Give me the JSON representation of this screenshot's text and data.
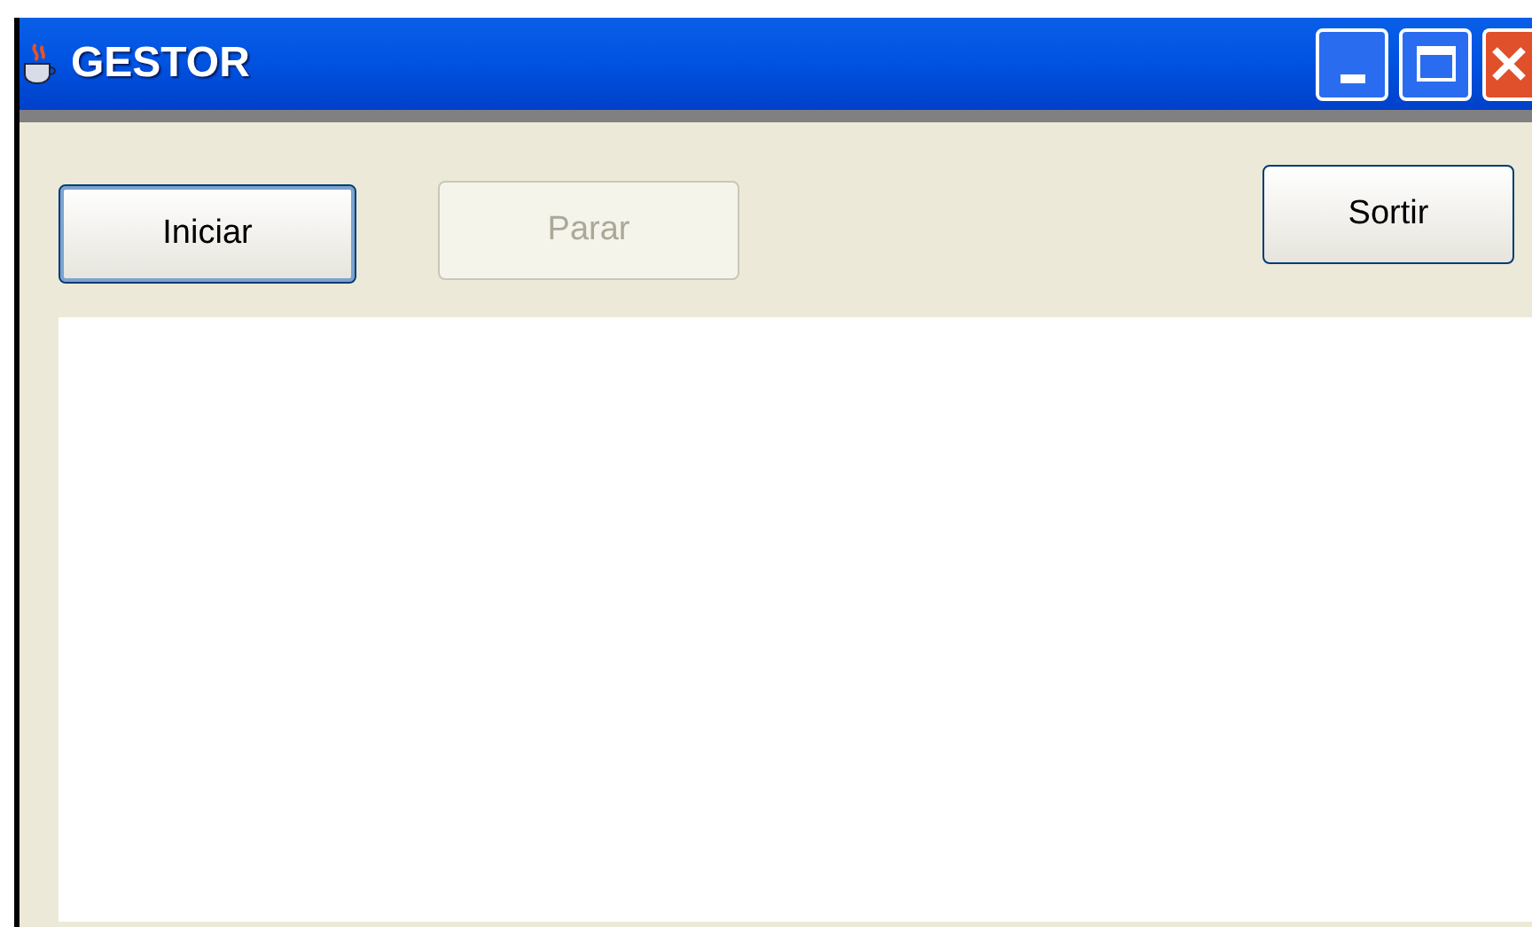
{
  "window": {
    "title": "GESTOR"
  },
  "buttons": [
    {
      "label": "Iniciar",
      "disabled": false,
      "focused": true
    },
    {
      "label": "Parar",
      "disabled": true,
      "focused": false
    },
    {
      "label": "Sortir",
      "disabled": false,
      "focused": false
    }
  ]
}
